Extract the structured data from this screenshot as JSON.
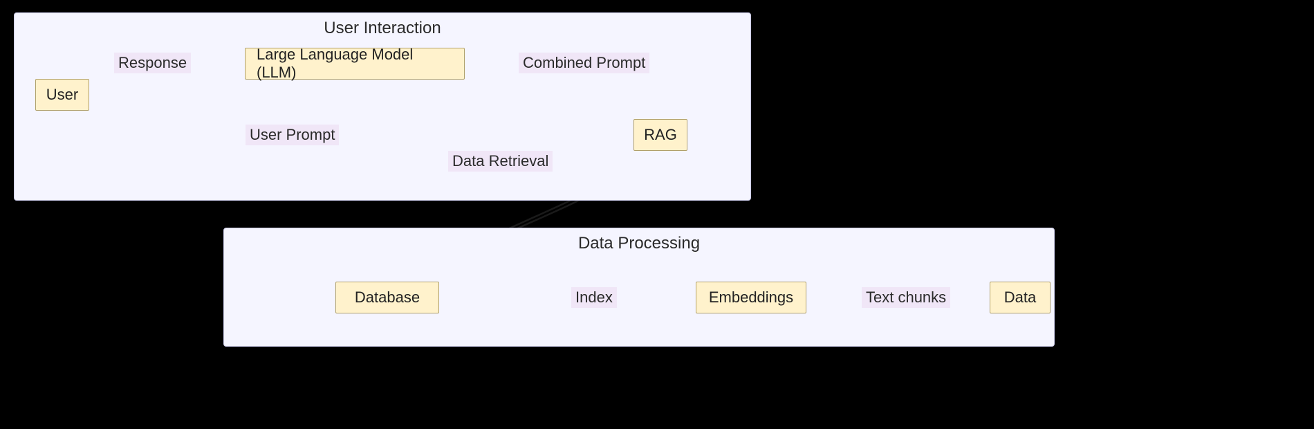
{
  "groups": {
    "ui": {
      "title": "User Interaction"
    },
    "dp": {
      "title": "Data Processing"
    }
  },
  "nodes": {
    "user": {
      "label": "User"
    },
    "llm": {
      "label": "Large Language Model (LLM)"
    },
    "rag": {
      "label": "RAG"
    },
    "database": {
      "label": "Database"
    },
    "embeddings": {
      "label": "Embeddings"
    },
    "data_node": {
      "label": "Data"
    }
  },
  "edges": {
    "response": {
      "label": "Response"
    },
    "combined_prompt": {
      "label": "Combined Prompt"
    },
    "user_prompt": {
      "label": "User Prompt"
    },
    "data_retrieval": {
      "label": "Data Retrieval"
    },
    "index": {
      "label": "Index"
    },
    "text_chunks": {
      "label": "Text chunks"
    }
  }
}
